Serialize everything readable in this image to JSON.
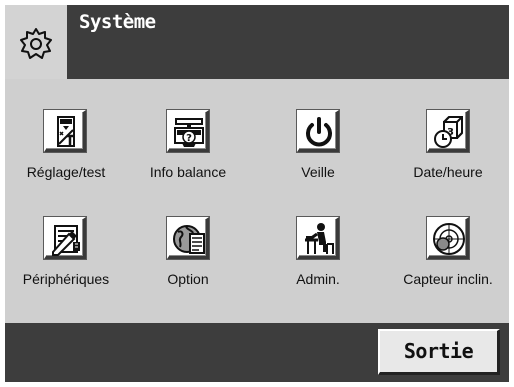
{
  "header": {
    "title": "Système",
    "icon": "gear-icon"
  },
  "tiles": [
    {
      "label": "Réglage/test",
      "icon": "calibration-weight-icon"
    },
    {
      "label": "Info balance",
      "icon": "balance-info-icon"
    },
    {
      "label": "Veille",
      "icon": "power-icon"
    },
    {
      "label": "Date/heure",
      "icon": "calendar-clock-icon"
    },
    {
      "label": "Périphériques",
      "icon": "peripherals-icon"
    },
    {
      "label": "Option",
      "icon": "globe-document-icon"
    },
    {
      "label": "Admin.",
      "icon": "admin-user-icon"
    },
    {
      "label": "Capteur inclin.",
      "icon": "level-sensor-icon"
    }
  ],
  "footer": {
    "exit_label": "Sortie"
  }
}
